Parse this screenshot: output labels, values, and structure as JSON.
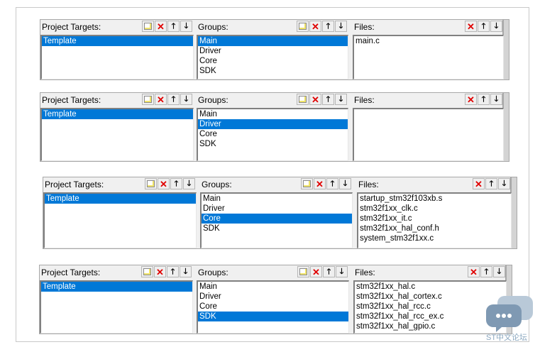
{
  "labels": {
    "targets": "Project Targets:",
    "groups": "Groups:",
    "files": "Files:"
  },
  "icons": {
    "new": "new-item-icon",
    "delete": "delete-icon",
    "up": "move-up-icon",
    "down": "move-down-icon"
  },
  "colors": {
    "selection": "#0078d7",
    "delete": "#e00000"
  },
  "panels": [
    {
      "targets": [
        "Template"
      ],
      "target_selected": 0,
      "groups": [
        "Main",
        "Driver",
        "Core",
        "SDK"
      ],
      "group_selected": 0,
      "files": [
        "main.c"
      ]
    },
    {
      "targets": [
        "Template"
      ],
      "target_selected": 0,
      "groups": [
        "Main",
        "Driver",
        "Core",
        "SDK"
      ],
      "group_selected": 1,
      "files": []
    },
    {
      "targets": [
        "Template"
      ],
      "target_selected": 0,
      "groups": [
        "Main",
        "Driver",
        "Core",
        "SDK"
      ],
      "group_selected": 2,
      "files": [
        "startup_stm32f103xb.s",
        "stm32f1xx_clk.c",
        "stm32f1xx_it.c",
        "stm32f1xx_hal_conf.h",
        "system_stm32f1xx.c"
      ]
    },
    {
      "targets": [
        "Template"
      ],
      "target_selected": 0,
      "groups": [
        "Main",
        "Driver",
        "Core",
        "SDK"
      ],
      "group_selected": 3,
      "files": [
        "stm32f1xx_hal.c",
        "stm32f1xx_hal_cortex.c",
        "stm32f1xx_hal_rcc.c",
        "stm32f1xx_hal_rcc_ex.c",
        "stm32f1xx_hal_gpio.c"
      ]
    }
  ],
  "watermark": {
    "text": "ST中文论坛"
  }
}
